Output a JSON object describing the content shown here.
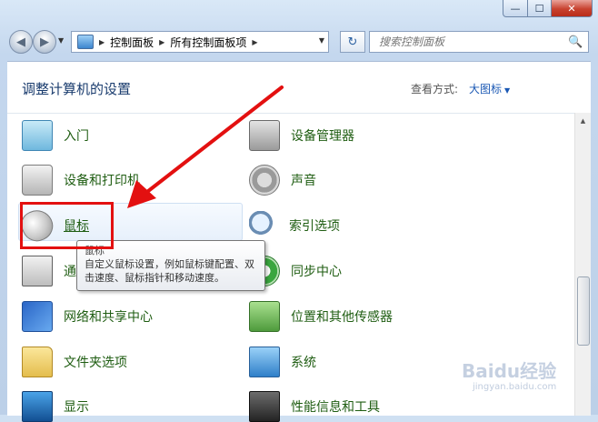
{
  "window": {
    "min_glyph": "—",
    "max_glyph": "☐",
    "close_glyph": "✕"
  },
  "nav": {
    "breadcrumb": [
      "控制面板",
      "所有控制面板项"
    ],
    "search_placeholder": "搜索控制面板"
  },
  "header": {
    "title": "调整计算机的设置",
    "view_by_label": "查看方式:",
    "view_by_value": "大图标"
  },
  "items": {
    "intro": "入门",
    "device_manager": "设备管理器",
    "devices_printers": "设备和打印机",
    "sound": "声音",
    "mouse": "鼠标",
    "indexing": "索引选项",
    "notification": "通",
    "sync_center": "同步中心",
    "network_sharing": "网络和共享中心",
    "location_sensors": "位置和其他传感器",
    "folder_options": "文件夹选项",
    "system": "系统",
    "display": "显示",
    "performance": "性能信息和工具"
  },
  "tooltip": {
    "title": "鼠标",
    "body": "自定义鼠标设置，例如鼠标键配置、双击速度、鼠标指针和移动速度。"
  },
  "watermark": {
    "logo": "Baidu经验",
    "url": "jingyan.baidu.com"
  },
  "colors": {
    "link_green": "#1f5d12",
    "title_blue": "#1a3c6e",
    "annotation_red": "#e31010"
  }
}
